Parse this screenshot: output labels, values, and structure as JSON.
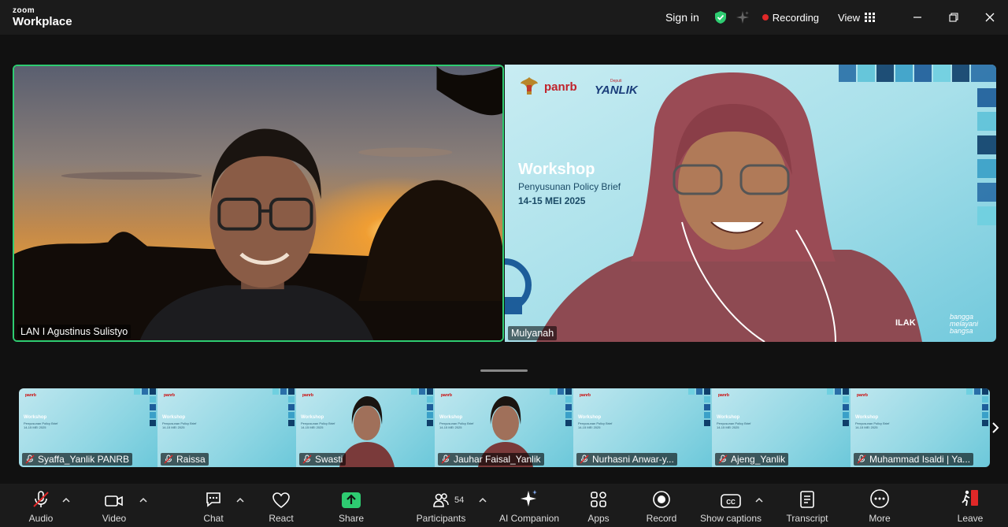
{
  "app": {
    "brand_small": "zoom",
    "brand_large": "Workplace"
  },
  "titlebar": {
    "sign_in": "Sign in",
    "recording": "Recording",
    "view": "View"
  },
  "colors": {
    "speaker_border": "#2ecc71",
    "record_dot": "#e02828",
    "shield": "#2ecc71",
    "leave": "#e02828"
  },
  "main": {
    "left_tile": {
      "name": "LAN I Agustinus Sulistyo"
    },
    "right_tile": {
      "name": "Mulyanah",
      "bg_logo": "panrb",
      "bg_logo2": "YANLIK",
      "bg_logo2_prefix": "Deputi",
      "bg_title": "Workshop",
      "bg_subtitle": "Penyusunan Policy Brief",
      "bg_date": "14-15 MEI 2025",
      "bg_footer_left": "ILAK",
      "bg_footer_right": "bangga melayani bangsa"
    }
  },
  "thumbs": [
    {
      "name": "Syaffa_Yanlik PANRB",
      "video": false
    },
    {
      "name": "Raissa",
      "video": false
    },
    {
      "name": "Swasti",
      "video": true
    },
    {
      "name": "Jauhar Faisal_Yanlik",
      "video": true
    },
    {
      "name": "Nurhasni Anwar-y...",
      "video": false
    },
    {
      "name": "Ajeng_Yanlik",
      "video": false
    },
    {
      "name": "Muhammad Isaldi | Ya...",
      "video": false
    }
  ],
  "thumb_bg": {
    "logo": "panrb",
    "title": "Workshop",
    "subtitle": "Penyusunan Policy Brief",
    "date": "14-15 MEI 2025"
  },
  "toolbar": {
    "audio": "Audio",
    "video": "Video",
    "chat": "Chat",
    "react": "React",
    "share": "Share",
    "participants": "Participants",
    "participants_count": "54",
    "ai_companion": "AI Companion",
    "apps": "Apps",
    "record": "Record",
    "captions": "Show captions",
    "transcript": "Transcript",
    "more": "More",
    "leave": "Leave"
  }
}
